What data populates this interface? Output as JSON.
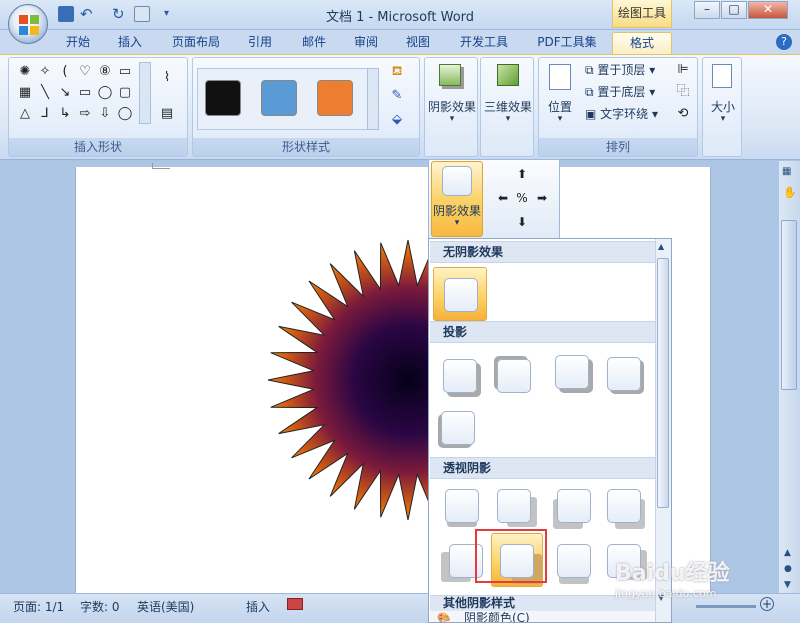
{
  "window": {
    "title": "文档 1 - Microsoft Word",
    "contextual_tab_group": "绘图工具",
    "buttons": {
      "minimize": "–",
      "maximize": "□",
      "close": "✕"
    }
  },
  "tabs": [
    "开始",
    "插入",
    "页面布局",
    "引用",
    "邮件",
    "审阅",
    "视图",
    "开发工具",
    "PDF工具集",
    "格式"
  ],
  "active_tab": "格式",
  "ribbon": {
    "insert_shapes_label": "插入形状",
    "shape_styles_label": "形状样式",
    "shape_style_swatches": [
      "#111111",
      "#5b9bd5",
      "#ed7d31"
    ],
    "shadow_effects_label": "阴影效果",
    "three_d_effects_label": "三维效果",
    "arrange_label": "排列",
    "position_label": "位置",
    "bring_to_front": "置于顶层",
    "send_to_back": "置于底层",
    "text_wrapping": "文字环绕",
    "size_label": "大小"
  },
  "shadow_dropdown": {
    "button_label": "阴影效果",
    "sections": {
      "no_shadow": "无阴影效果",
      "drop_shadow": "投影",
      "perspective_shadow": "透视阴影",
      "other": "其他阴影样式"
    },
    "footer_item": "阴影颜色(C)"
  },
  "status": {
    "page": "页面: 1/1",
    "words": "字数: 0",
    "language": "英语(美国)",
    "mode": "插入"
  },
  "watermark": "Baidu经验",
  "watermark_sub": "jingyan.baidu.com"
}
